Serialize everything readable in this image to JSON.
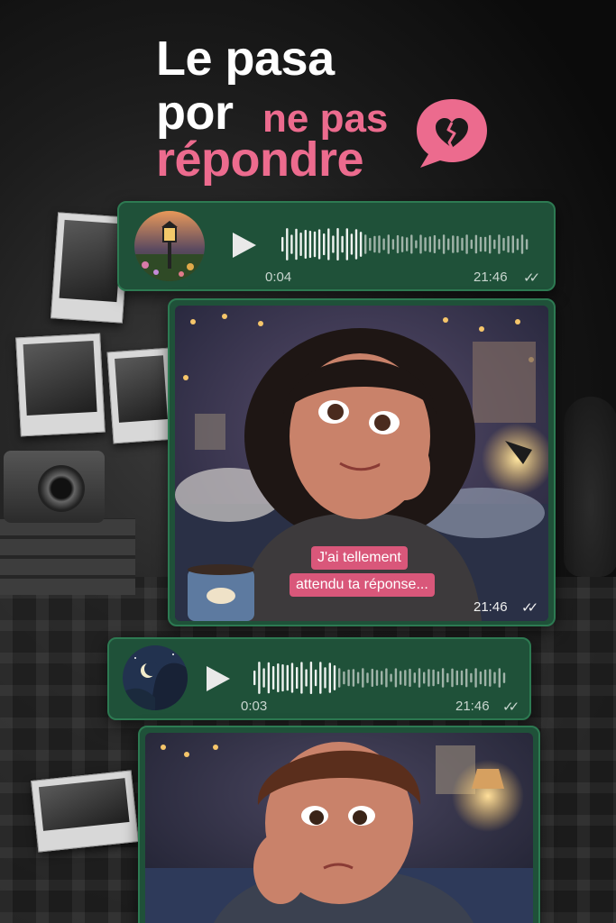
{
  "headline": {
    "line1": "Le pasa",
    "line2": "por",
    "line2_accent": "ne pas",
    "line3_accent": "répondre"
  },
  "colors": {
    "accent_pink": "#ec6b8e",
    "bubble_green": "#1f5139",
    "bubble_border": "#2d7a52"
  },
  "messages": [
    {
      "kind": "voice",
      "avatar_icon": "lantern-garden-avatar",
      "duration": "0:04",
      "time": "21:46",
      "status": "✓✓"
    },
    {
      "kind": "photo",
      "image_icon": "smiling-girl-illustration",
      "caption_line1": "J'ai tellement",
      "caption_line2": "attendu ta réponse...",
      "time": "21:46",
      "status": "✓✓"
    },
    {
      "kind": "voice",
      "avatar_icon": "moon-night-avatar",
      "duration": "0:03",
      "time": "21:46",
      "status": "✓✓"
    },
    {
      "kind": "photo",
      "image_icon": "sad-boy-illustration"
    }
  ],
  "icons": {
    "broken_heart": "broken-heart-speech-bubble-icon",
    "play": "play-icon"
  }
}
